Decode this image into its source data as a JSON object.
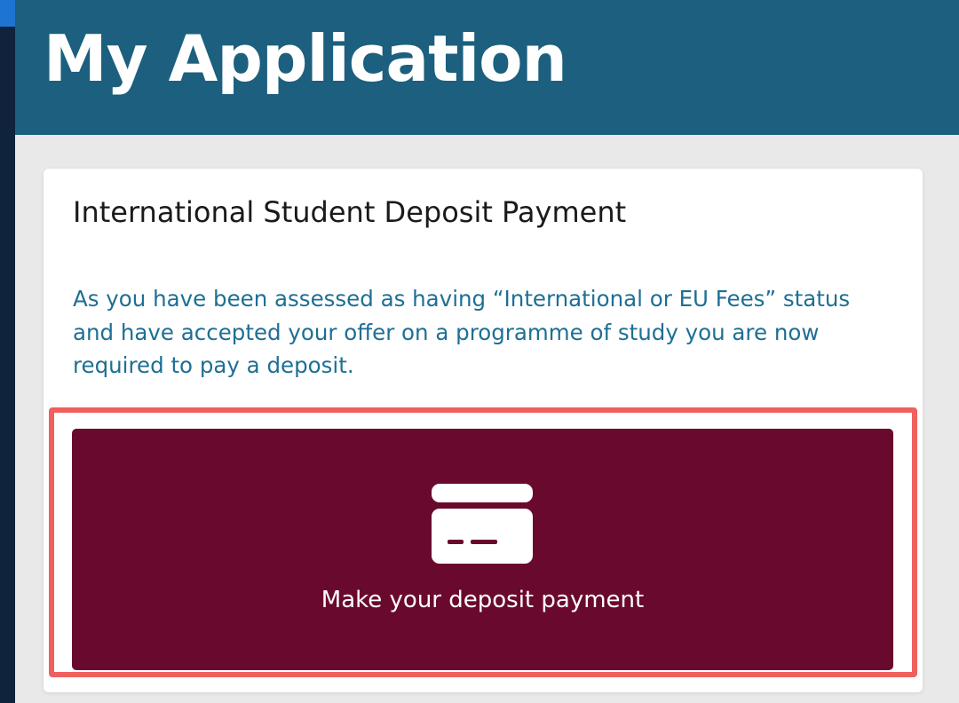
{
  "header": {
    "title": "My Application"
  },
  "deposit_card": {
    "title": "International Student Deposit Payment",
    "description": "As you have been assessed as having “International or EU Fees” status and have accepted your offer on a programme of study you are now required to pay a deposit.",
    "button": {
      "label": "Make your deposit payment",
      "icon": "credit-card-icon"
    }
  },
  "colors": {
    "header_bg": "#1c5f7e",
    "button_bg": "#6a092e",
    "description_text": "#1e6f94",
    "highlight_border": "#f0605e",
    "left_rail": "#10233d",
    "left_rail_accent": "#1e74d3"
  }
}
